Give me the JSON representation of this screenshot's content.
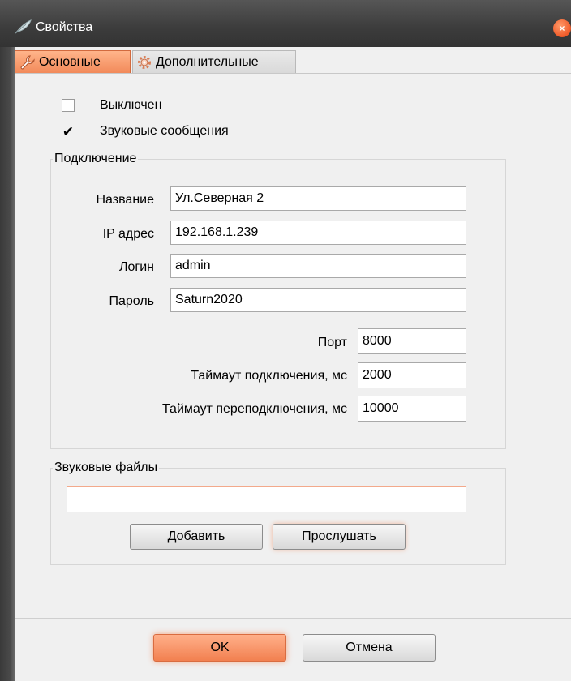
{
  "window": {
    "title": "Свойства",
    "close_glyph": "×"
  },
  "tabs": [
    {
      "label": "Основные",
      "icon": "wrench-icon",
      "active": true
    },
    {
      "label": "Дополнительные",
      "icon": "gear-icon",
      "active": false
    }
  ],
  "checks": {
    "disabled": {
      "label": "Выключен",
      "checked": false
    },
    "sound_messages": {
      "label": "Звуковые сообщения",
      "checked": true,
      "mark": "✔"
    }
  },
  "connection": {
    "legend": "Подключение",
    "name_label": "Название",
    "name_value": "Ул.Северная 2",
    "ip_label": "IP адрес",
    "ip_value": "192.168.1.239",
    "login_label": "Логин",
    "login_value": "admin",
    "password_label": "Пароль",
    "password_value": "Saturn2020",
    "port_label": "Порт",
    "port_value": "8000",
    "timeout_label": "Таймаут подключения, мс",
    "timeout_value": "2000",
    "reconnect_label": "Таймаут переподключения, мс",
    "reconnect_value": "10000"
  },
  "sound_files": {
    "legend": "Звуковые файлы",
    "path_value": "",
    "add_label": "Добавить",
    "listen_label": "Прослушать"
  },
  "footer": {
    "ok_label": "OK",
    "cancel_label": "Отмена"
  },
  "colors": {
    "accent": "#f28a5a",
    "titlebar": "#3c3c3c"
  }
}
